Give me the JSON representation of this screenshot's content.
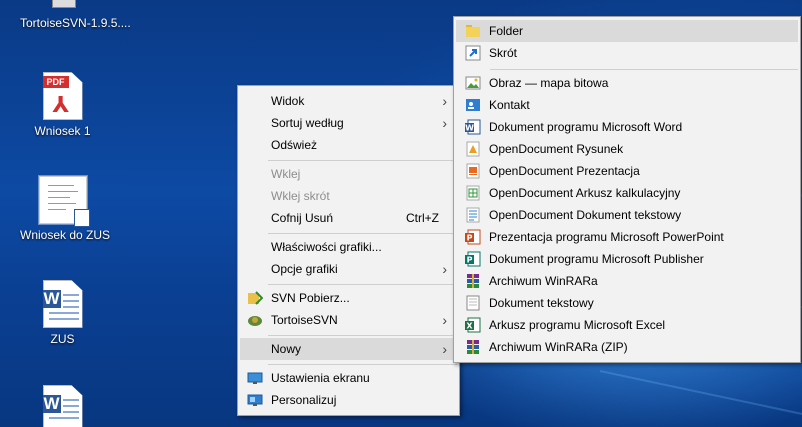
{
  "desktop": {
    "icons": [
      {
        "label": "TortoiseSVN-1.9.5...."
      },
      {
        "label": "Wniosek 1",
        "badge": "PDF"
      },
      {
        "label": "Wniosek do ZUS"
      },
      {
        "label": "ZUS",
        "badge": "W"
      },
      {
        "label": "",
        "badge": "W"
      }
    ]
  },
  "context_menu": {
    "items": [
      {
        "label": "Widok"
      },
      {
        "label": "Sortuj według"
      },
      {
        "label": "Odśwież"
      },
      {
        "label": "Wklej"
      },
      {
        "label": "Wklej skrót"
      },
      {
        "label": "Cofnij Usuń",
        "shortcut": "Ctrl+Z"
      },
      {
        "label": "Właściwości grafiki..."
      },
      {
        "label": "Opcje grafiki"
      },
      {
        "label": "SVN Pobierz..."
      },
      {
        "label": "TortoiseSVN"
      },
      {
        "label": "Nowy"
      },
      {
        "label": "Ustawienia ekranu"
      },
      {
        "label": "Personalizuj"
      }
    ],
    "submenu_arrow": "›"
  },
  "new_submenu": {
    "items": [
      {
        "label": "Folder",
        "icon": "folder-icon"
      },
      {
        "label": "Skrót",
        "icon": "shortcut-icon"
      },
      {
        "label": "Obraz — mapa bitowa",
        "icon": "bitmap-icon"
      },
      {
        "label": "Kontakt",
        "icon": "contact-icon"
      },
      {
        "label": "Dokument programu Microsoft Word",
        "icon": "word-doc-icon"
      },
      {
        "label": "OpenDocument Rysunek",
        "icon": "odg-icon"
      },
      {
        "label": "OpenDocument Prezentacja",
        "icon": "odp-icon"
      },
      {
        "label": "OpenDocument Arkusz kalkulacyjny",
        "icon": "ods-icon"
      },
      {
        "label": "OpenDocument Dokument tekstowy",
        "icon": "odt-icon"
      },
      {
        "label": "Prezentacja programu Microsoft PowerPoint",
        "icon": "pptx-icon"
      },
      {
        "label": "Dokument programu Microsoft Publisher",
        "icon": "publisher-icon"
      },
      {
        "label": "Archiwum WinRARa",
        "icon": "winrar-icon"
      },
      {
        "label": "Dokument tekstowy",
        "icon": "text-doc-icon"
      },
      {
        "label": "Arkusz programu Microsoft Excel",
        "icon": "excel-icon"
      },
      {
        "label": "Archiwum WinRARa (ZIP)",
        "icon": "winrar-zip-icon"
      }
    ]
  },
  "colors": {
    "menu_bg": "#f2f2f2",
    "highlight": "#dadada",
    "disabled_text": "#8d8d8d",
    "desktop_blue": "#0b3f8c"
  }
}
